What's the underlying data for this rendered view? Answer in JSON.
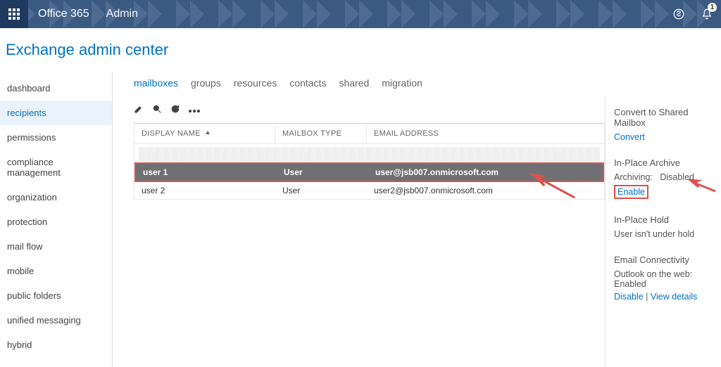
{
  "topbar": {
    "brand": "Office 365",
    "crumb": "Admin",
    "notification_count": "1"
  },
  "page_title": "Exchange admin center",
  "sidebar": {
    "items": [
      {
        "label": "dashboard"
      },
      {
        "label": "recipients"
      },
      {
        "label": "permissions"
      },
      {
        "label": "compliance management"
      },
      {
        "label": "organization"
      },
      {
        "label": "protection"
      },
      {
        "label": "mail flow"
      },
      {
        "label": "mobile"
      },
      {
        "label": "public folders"
      },
      {
        "label": "unified messaging"
      },
      {
        "label": "hybrid"
      }
    ],
    "active_index": 1
  },
  "tabs": {
    "items": [
      "mailboxes",
      "groups",
      "resources",
      "contacts",
      "shared",
      "migration"
    ],
    "active_index": 0
  },
  "table": {
    "headers": {
      "name": "DISPLAY NAME",
      "type": "MAILBOX TYPE",
      "email": "EMAIL ADDRESS"
    },
    "rows": [
      {
        "name": "user 1",
        "type": "User",
        "email": "user@jsb007.onmicrosoft.com",
        "selected": true
      },
      {
        "name": "user 2",
        "type": "User",
        "email": "user2@jsb007.onmicrosoft.com",
        "selected": false
      }
    ]
  },
  "details": {
    "convert_title": "Convert to Shared Mailbox",
    "convert_link": "Convert",
    "archive_title": "In-Place Archive",
    "archive_status_label": "Archiving:",
    "archive_status_value": "Disabled",
    "archive_action": "Enable",
    "hold_title": "In-Place Hold",
    "hold_status": "User isn't under hold",
    "connectivity_title": "Email Connectivity",
    "connectivity_status_label": "Outlook on the web:",
    "connectivity_status_value": "Enabled",
    "connectivity_disable": "Disable",
    "connectivity_sep": "|",
    "connectivity_details": "View details"
  }
}
